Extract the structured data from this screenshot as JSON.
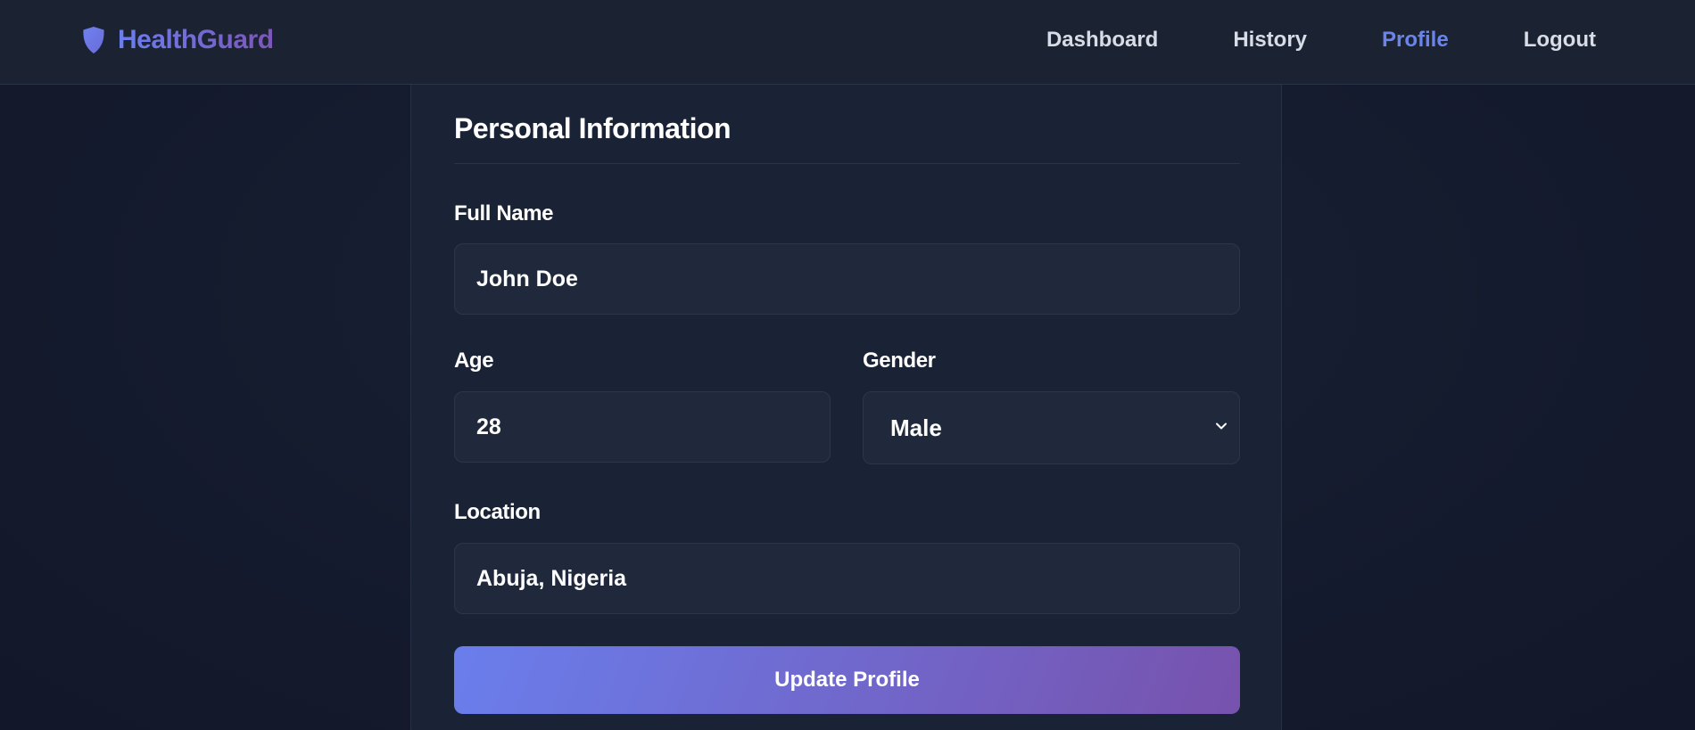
{
  "app": {
    "brand_name": "HealthGuard",
    "brand_icon": "shield-icon"
  },
  "nav": {
    "items": [
      {
        "label": "Dashboard",
        "active": false
      },
      {
        "label": "History",
        "active": false
      },
      {
        "label": "Profile",
        "active": true
      },
      {
        "label": "Logout",
        "active": false
      }
    ]
  },
  "form": {
    "title": "Personal Information",
    "full_name": {
      "label": "Full Name",
      "value": "John Doe"
    },
    "age": {
      "label": "Age",
      "value": "28"
    },
    "gender": {
      "label": "Gender",
      "value": "Male",
      "options": [
        "Male"
      ]
    },
    "location": {
      "label": "Location",
      "value": "Abuja, Nigeria"
    },
    "submit_label": "Update Profile"
  },
  "colors": {
    "background": "#151b2e",
    "navbar": "#1b2333",
    "card": "#1a2335",
    "input": "#1f293b",
    "accent_start": "#6a7eec",
    "accent_end": "#7752ad",
    "active_link": "#6b84ec"
  }
}
